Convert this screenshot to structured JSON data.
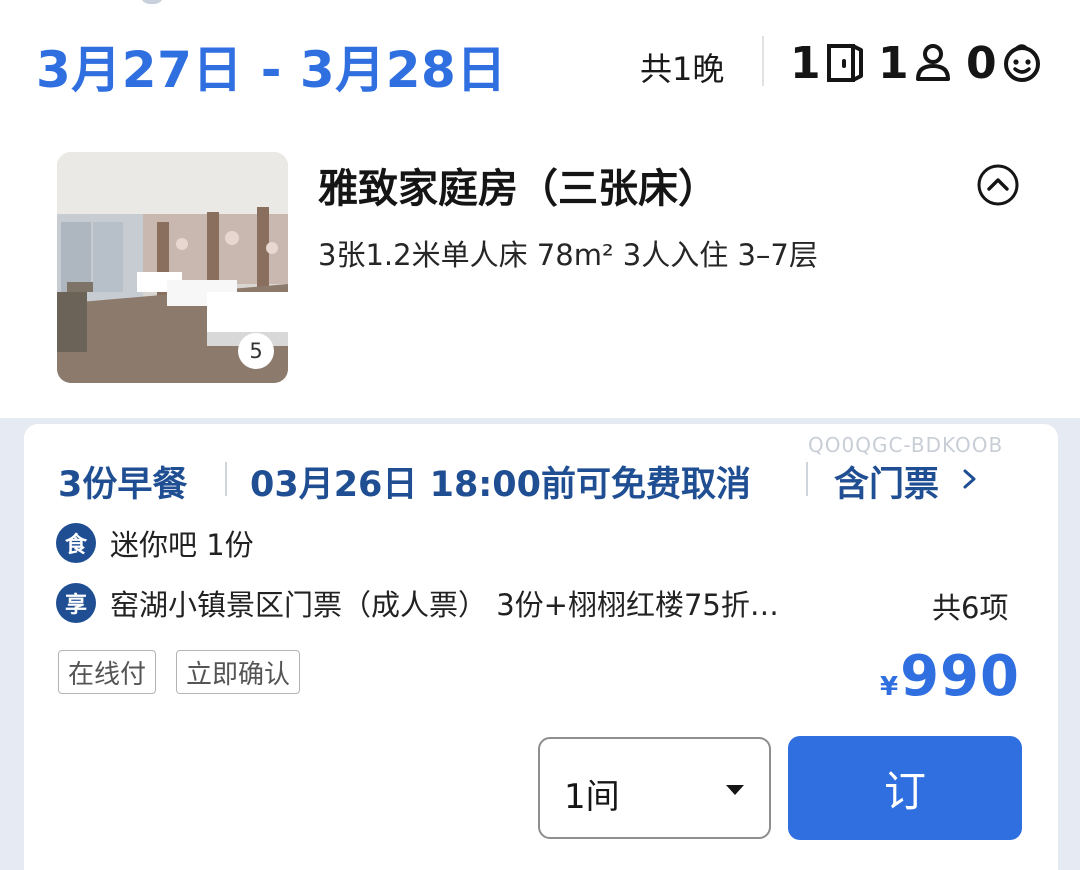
{
  "header": {
    "dates": "3月27日 - 3月28日",
    "nights": "共1晚",
    "rooms_count": "1",
    "adults_count": "1",
    "children_count": "0"
  },
  "room": {
    "title": "雅致家庭房（三张床）",
    "specs": "3张1.2米单人床  78m²  3人入住  3–7层",
    "image_count": "5"
  },
  "offer": {
    "watermark": "QO0QGC-BDKOOB",
    "breakfast": "3份早餐",
    "cancellation": "03月26日 18:00前可免费取消",
    "tickets": "含门票",
    "perks": [
      {
        "icon_char": "食",
        "icon": "food-badge-icon",
        "text": "迷你吧 1份"
      },
      {
        "icon_char": "享",
        "icon": "enjoy-badge-icon",
        "text": "窑湖小镇景区门票（成人票） 3份+栩栩红楼75折…"
      }
    ],
    "perk_total": "共6项",
    "tags": [
      "在线付",
      "立即确认"
    ],
    "currency": "¥",
    "price": "990",
    "quantity": "1间",
    "book_label": "订"
  },
  "colors": {
    "accent": "#2f6fe0",
    "dark_blue": "#1f4e93"
  }
}
